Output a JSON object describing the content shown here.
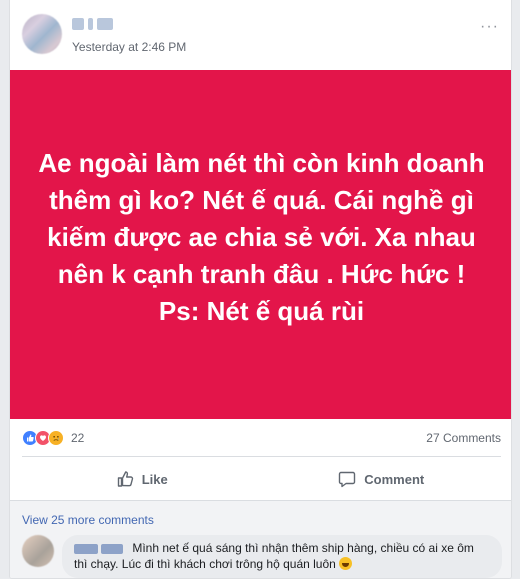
{
  "post": {
    "timestamp": "Yesterday at 2:46 PM",
    "more_menu": "···",
    "status_text": "Ae ngoài làm nét thì còn kinh doanh thêm gì ko? Nét ế quá. Cái nghề gì kiếm được ae chia sẻ với. Xa nhau nên k cạnh tranh đâu . Hức hức ! Ps: Nét ế quá rùi",
    "background_color": "#e3154a"
  },
  "reactions": {
    "icons": [
      "like-icon",
      "love-icon",
      "sad-icon"
    ],
    "count": "22",
    "comments_count": "27 Comments"
  },
  "actions": {
    "like_label": "Like",
    "comment_label": "Comment"
  },
  "comments": {
    "view_more": "View 25 more comments",
    "items": [
      {
        "text": "Mình net ế quá sáng thì nhận thêm ship hàng, chiều có ai xe ôm thì chạy. Lúc đi thì khách chơi trông hộ quán luôn",
        "emoji": "laughing-emoji"
      }
    ]
  },
  "colors": {
    "link": "#4267b2",
    "meta_text": "#616770"
  }
}
